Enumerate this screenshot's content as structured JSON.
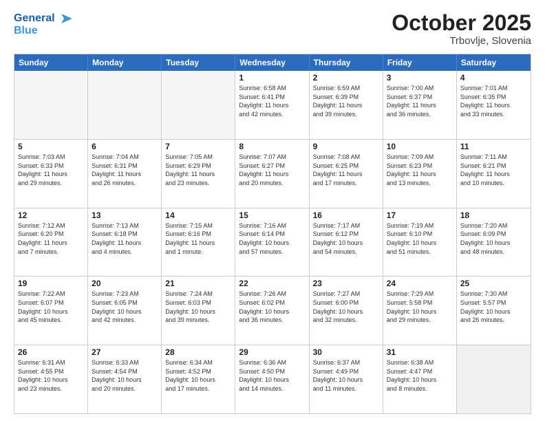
{
  "header": {
    "logo_general": "General",
    "logo_blue": "Blue",
    "month_title": "October 2025",
    "subtitle": "Trbovlje, Slovenia"
  },
  "weekdays": [
    "Sunday",
    "Monday",
    "Tuesday",
    "Wednesday",
    "Thursday",
    "Friday",
    "Saturday"
  ],
  "rows": [
    [
      {
        "day": "",
        "info": "",
        "empty": true
      },
      {
        "day": "",
        "info": "",
        "empty": true
      },
      {
        "day": "",
        "info": "",
        "empty": true
      },
      {
        "day": "1",
        "info": "Sunrise: 6:58 AM\nSunset: 6:41 PM\nDaylight: 11 hours\nand 42 minutes."
      },
      {
        "day": "2",
        "info": "Sunrise: 6:59 AM\nSunset: 6:39 PM\nDaylight: 11 hours\nand 39 minutes."
      },
      {
        "day": "3",
        "info": "Sunrise: 7:00 AM\nSunset: 6:37 PM\nDaylight: 11 hours\nand 36 minutes."
      },
      {
        "day": "4",
        "info": "Sunrise: 7:01 AM\nSunset: 6:35 PM\nDaylight: 11 hours\nand 33 minutes."
      }
    ],
    [
      {
        "day": "5",
        "info": "Sunrise: 7:03 AM\nSunset: 6:33 PM\nDaylight: 11 hours\nand 29 minutes."
      },
      {
        "day": "6",
        "info": "Sunrise: 7:04 AM\nSunset: 6:31 PM\nDaylight: 11 hours\nand 26 minutes."
      },
      {
        "day": "7",
        "info": "Sunrise: 7:05 AM\nSunset: 6:29 PM\nDaylight: 11 hours\nand 23 minutes."
      },
      {
        "day": "8",
        "info": "Sunrise: 7:07 AM\nSunset: 6:27 PM\nDaylight: 11 hours\nand 20 minutes."
      },
      {
        "day": "9",
        "info": "Sunrise: 7:08 AM\nSunset: 6:25 PM\nDaylight: 11 hours\nand 17 minutes."
      },
      {
        "day": "10",
        "info": "Sunrise: 7:09 AM\nSunset: 6:23 PM\nDaylight: 11 hours\nand 13 minutes."
      },
      {
        "day": "11",
        "info": "Sunrise: 7:11 AM\nSunset: 6:21 PM\nDaylight: 11 hours\nand 10 minutes."
      }
    ],
    [
      {
        "day": "12",
        "info": "Sunrise: 7:12 AM\nSunset: 6:20 PM\nDaylight: 11 hours\nand 7 minutes."
      },
      {
        "day": "13",
        "info": "Sunrise: 7:13 AM\nSunset: 6:18 PM\nDaylight: 11 hours\nand 4 minutes."
      },
      {
        "day": "14",
        "info": "Sunrise: 7:15 AM\nSunset: 6:16 PM\nDaylight: 11 hours\nand 1 minute."
      },
      {
        "day": "15",
        "info": "Sunrise: 7:16 AM\nSunset: 6:14 PM\nDaylight: 10 hours\nand 57 minutes."
      },
      {
        "day": "16",
        "info": "Sunrise: 7:17 AM\nSunset: 6:12 PM\nDaylight: 10 hours\nand 54 minutes."
      },
      {
        "day": "17",
        "info": "Sunrise: 7:19 AM\nSunset: 6:10 PM\nDaylight: 10 hours\nand 51 minutes."
      },
      {
        "day": "18",
        "info": "Sunrise: 7:20 AM\nSunset: 6:09 PM\nDaylight: 10 hours\nand 48 minutes."
      }
    ],
    [
      {
        "day": "19",
        "info": "Sunrise: 7:22 AM\nSunset: 6:07 PM\nDaylight: 10 hours\nand 45 minutes."
      },
      {
        "day": "20",
        "info": "Sunrise: 7:23 AM\nSunset: 6:05 PM\nDaylight: 10 hours\nand 42 minutes."
      },
      {
        "day": "21",
        "info": "Sunrise: 7:24 AM\nSunset: 6:03 PM\nDaylight: 10 hours\nand 39 minutes."
      },
      {
        "day": "22",
        "info": "Sunrise: 7:26 AM\nSunset: 6:02 PM\nDaylight: 10 hours\nand 36 minutes."
      },
      {
        "day": "23",
        "info": "Sunrise: 7:27 AM\nSunset: 6:00 PM\nDaylight: 10 hours\nand 32 minutes."
      },
      {
        "day": "24",
        "info": "Sunrise: 7:29 AM\nSunset: 5:58 PM\nDaylight: 10 hours\nand 29 minutes."
      },
      {
        "day": "25",
        "info": "Sunrise: 7:30 AM\nSunset: 5:57 PM\nDaylight: 10 hours\nand 26 minutes."
      }
    ],
    [
      {
        "day": "26",
        "info": "Sunrise: 6:31 AM\nSunset: 4:55 PM\nDaylight: 10 hours\nand 23 minutes."
      },
      {
        "day": "27",
        "info": "Sunrise: 6:33 AM\nSunset: 4:54 PM\nDaylight: 10 hours\nand 20 minutes."
      },
      {
        "day": "28",
        "info": "Sunrise: 6:34 AM\nSunset: 4:52 PM\nDaylight: 10 hours\nand 17 minutes."
      },
      {
        "day": "29",
        "info": "Sunrise: 6:36 AM\nSunset: 4:50 PM\nDaylight: 10 hours\nand 14 minutes."
      },
      {
        "day": "30",
        "info": "Sunrise: 6:37 AM\nSunset: 4:49 PM\nDaylight: 10 hours\nand 11 minutes."
      },
      {
        "day": "31",
        "info": "Sunrise: 6:38 AM\nSunset: 4:47 PM\nDaylight: 10 hours\nand 8 minutes."
      },
      {
        "day": "",
        "info": "",
        "empty": true,
        "shaded": true
      }
    ]
  ]
}
